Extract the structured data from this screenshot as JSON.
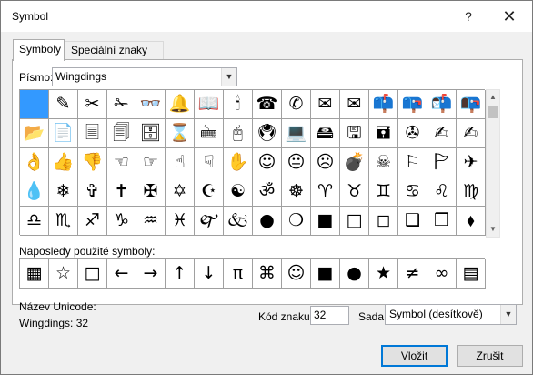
{
  "window": {
    "title": "Symbol",
    "help": "?",
    "close": "✕"
  },
  "tabs": [
    {
      "label": "Symboly"
    },
    {
      "label": "Speciální znaky"
    }
  ],
  "font": {
    "label": "Písmo:",
    "value": "Wingdings"
  },
  "grid_symbols": [
    [
      "",
      "✎",
      "✂",
      "✁",
      "👓",
      "🔔",
      "📖",
      "🕯",
      "☎",
      "✆",
      "✉",
      "✉",
      "📫",
      "📪",
      "📬",
      "📭"
    ],
    [
      "📁",
      "📂",
      "📄",
      "🗏",
      "🗐",
      "🗄",
      "⌛",
      "🖮",
      "🖰",
      "🖲",
      "💻",
      "🖴",
      "🖫",
      "🖬",
      "✇",
      "✍"
    ],
    [
      "✌",
      "👌",
      "👍",
      "👎",
      "☜",
      "☞",
      "☝",
      "☟",
      "✋",
      "☺",
      "😐",
      "☹",
      "💣",
      "☠",
      "⚐",
      "🏱"
    ],
    [
      "✈",
      "☼",
      "💧",
      "❄",
      "✞",
      "✝",
      "✠",
      "✡",
      "☪",
      "☯",
      "ॐ",
      "☸",
      "♈",
      "♉",
      "♊",
      "♋"
    ],
    [
      "♌",
      "♍",
      "♎",
      "♏",
      "♐",
      "♑",
      "♒",
      "♓",
      "🙰",
      "🙵",
      "●",
      "❍",
      "■",
      "□",
      "◻",
      "❑"
    ]
  ],
  "grid_symbols_visible": [
    [
      "",
      "✎",
      "✂",
      "✁",
      "👓",
      "🔔",
      "📖",
      "🕯",
      "☎",
      "✆",
      "✉",
      "✉",
      "📫",
      "📪",
      "📬",
      "📭",
      "▭"
    ],
    [
      "📂",
      "📄",
      "🗏",
      "🗐",
      "🗄",
      "⌛",
      "🖮",
      "🖰",
      "🖲",
      "💻",
      "🖴",
      "🖫",
      "🖬",
      "✇",
      "✍",
      "✍",
      "✌"
    ],
    [
      "👌",
      "👍",
      "👎",
      "☜",
      "☞",
      "☝",
      "☟",
      "✋",
      "☺",
      "😐",
      "☹",
      "💣",
      "☠",
      "⚐",
      "🏱",
      "✈",
      "☼"
    ],
    [
      "💧",
      "❄",
      "✞",
      "✝",
      "✠",
      "✡",
      "☪",
      "☯",
      "ॐ",
      "☸",
      "♈",
      "♉",
      "♊",
      "♋",
      "♌",
      "♍",
      ""
    ],
    [
      "♎",
      "♏",
      "♐",
      "♑",
      "♒",
      "♓",
      "🙰",
      "🙵",
      "●",
      "❍",
      "■",
      "□",
      "◻",
      "❑",
      "❒",
      "⬧",
      "⧫"
    ]
  ],
  "recent": {
    "label": "Naposledy použité symboly:",
    "symbols": [
      "▦",
      "☆",
      "□",
      "←",
      "→",
      "↑",
      "↓",
      "π",
      "⌘",
      "☺",
      "■",
      "●",
      "★",
      "≠",
      "∞",
      "▤",
      "🗎"
    ]
  },
  "unicode": {
    "label": "Název Unicode:",
    "value": "Wingdings: 32"
  },
  "code": {
    "label": "Kód znaku:",
    "value": "32"
  },
  "from": {
    "label": "Sada:",
    "value": "Symbol (desítkově)"
  },
  "buttons": {
    "insert": "Vložit",
    "cancel": "Zrušit"
  },
  "colors": {
    "selected": "#3399ff",
    "accent": "#0078d7"
  }
}
